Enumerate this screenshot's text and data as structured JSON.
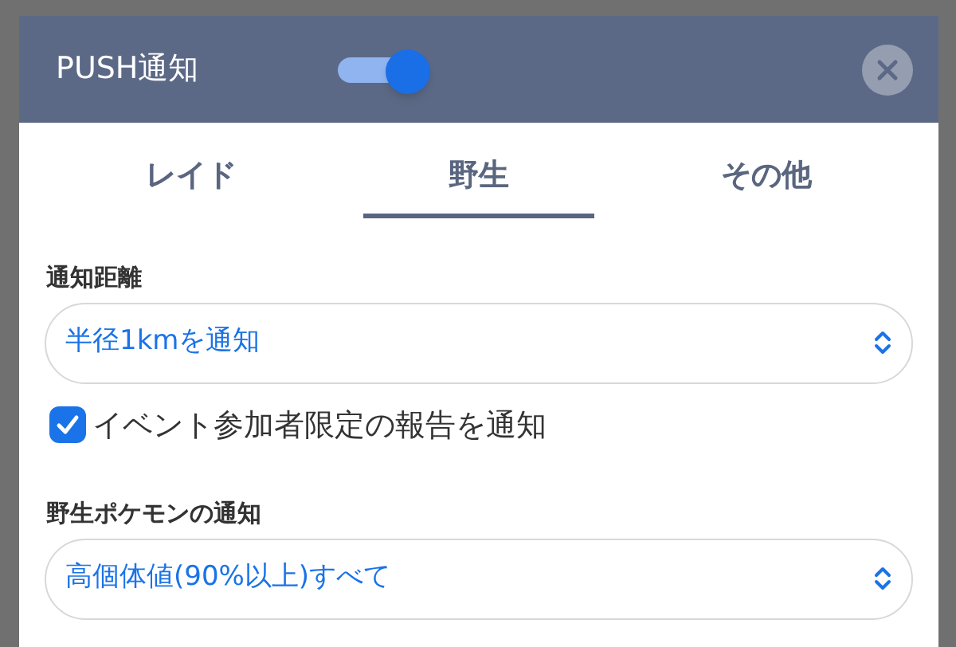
{
  "dialog": {
    "title": "PUSH通知",
    "push_enabled": true
  },
  "tabs": [
    {
      "label": "レイド",
      "selected": false
    },
    {
      "label": "野生",
      "selected": true
    },
    {
      "label": "その他",
      "selected": false
    }
  ],
  "fields": [
    {
      "kind": "select",
      "label": "通知距離",
      "value": "半径1kmを通知"
    },
    {
      "kind": "checkbox",
      "label": "イベント参加者限定の報告を通知",
      "checked": true
    },
    {
      "kind": "select",
      "label": "野生ポケモンの通知",
      "value": "高個体値(90%以上)すべて"
    }
  ]
}
